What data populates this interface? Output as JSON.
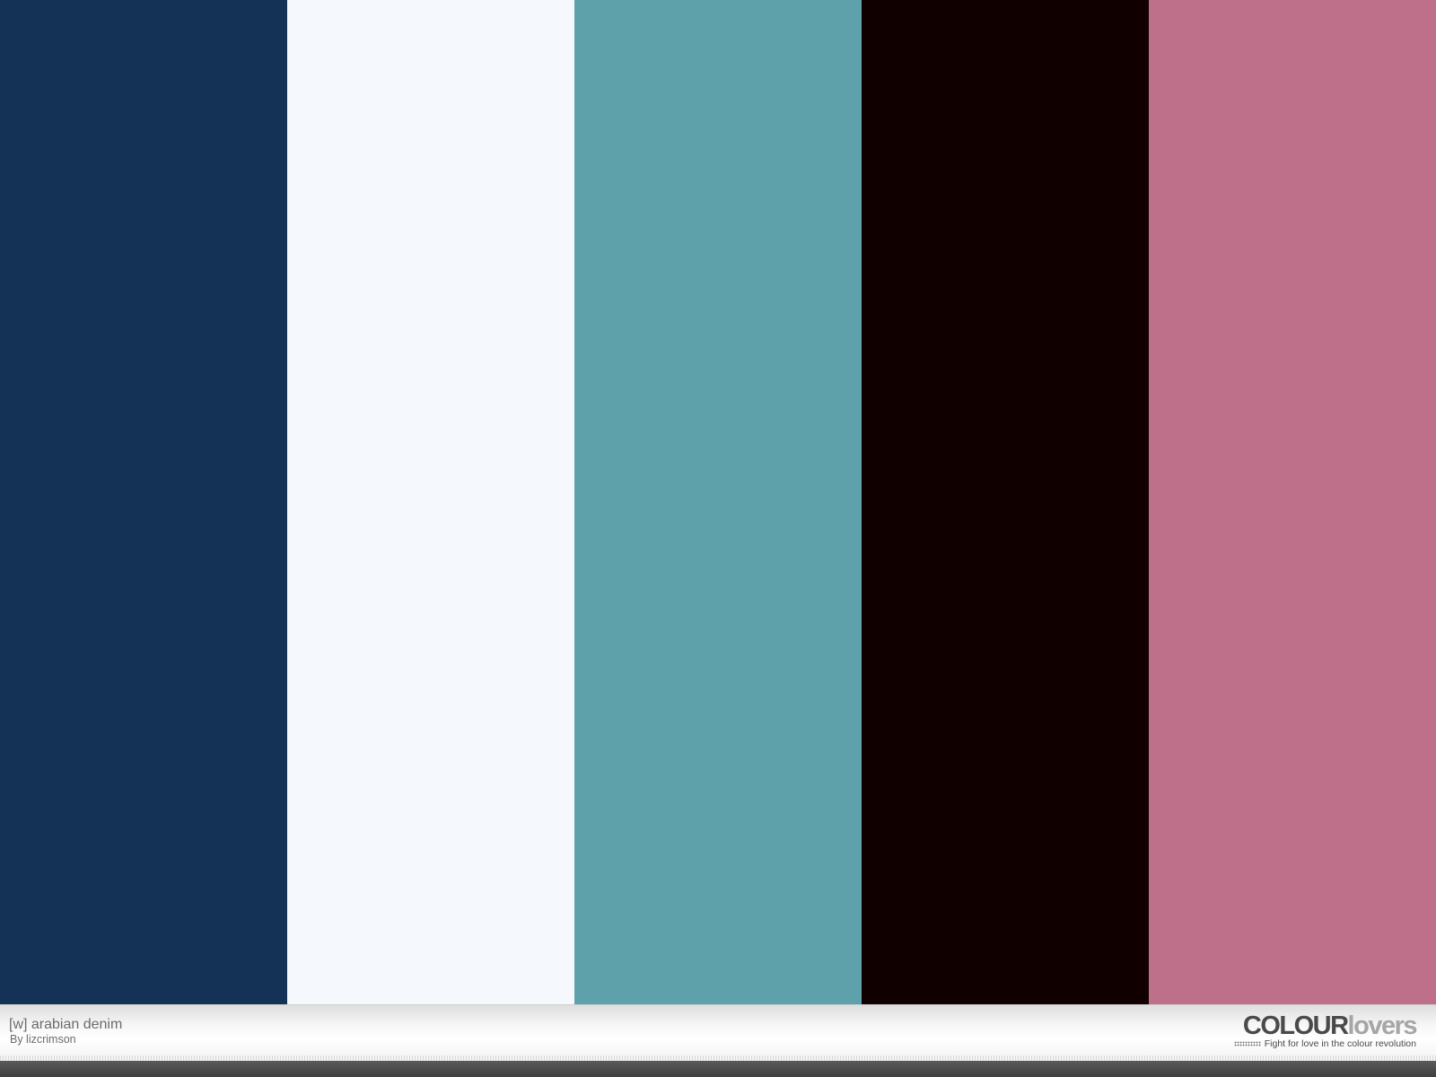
{
  "palette": {
    "title": "[w] arabian denim",
    "author": "By lizcrimson",
    "colors": [
      {
        "name": "swatch-1",
        "hex": "#143156"
      },
      {
        "name": "swatch-2",
        "hex": "#F5F9FE"
      },
      {
        "name": "swatch-3",
        "hex": "#5EA1AB"
      },
      {
        "name": "swatch-4",
        "hex": "#110000"
      },
      {
        "name": "swatch-5",
        "hex": "#BE6F89"
      }
    ]
  },
  "branding": {
    "logo_strong": "COLOUR",
    "logo_light": "lovers",
    "tagline": "Fight for love in the colour revolution"
  }
}
